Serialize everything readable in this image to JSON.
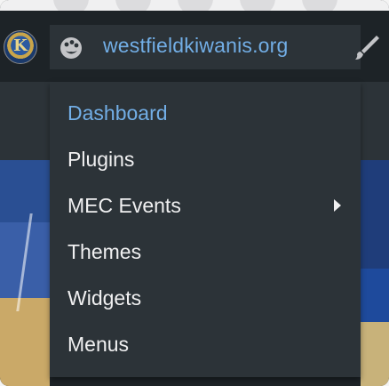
{
  "adminbar": {
    "site_name": "westfieldkiwanis.org",
    "logo_letter": "K",
    "icons": {
      "logo": "kiwanis-logo-icon",
      "site": "dashboard-palette-icon",
      "customize": "paintbrush-icon",
      "home": "home-icon"
    }
  },
  "menu": {
    "items": [
      {
        "label": "Dashboard",
        "current": true,
        "has_submenu": false
      },
      {
        "label": "Plugins",
        "current": false,
        "has_submenu": false
      },
      {
        "label": "MEC Events",
        "current": false,
        "has_submenu": true
      },
      {
        "label": "Themes",
        "current": false,
        "has_submenu": false
      },
      {
        "label": "Widgets",
        "current": false,
        "has_submenu": false
      },
      {
        "label": "Menus",
        "current": false,
        "has_submenu": false
      }
    ]
  },
  "colors": {
    "bar": "#1d2327",
    "menu_bg": "#2c3338",
    "accent": "#72aee6",
    "text": "#f0f0f1"
  }
}
